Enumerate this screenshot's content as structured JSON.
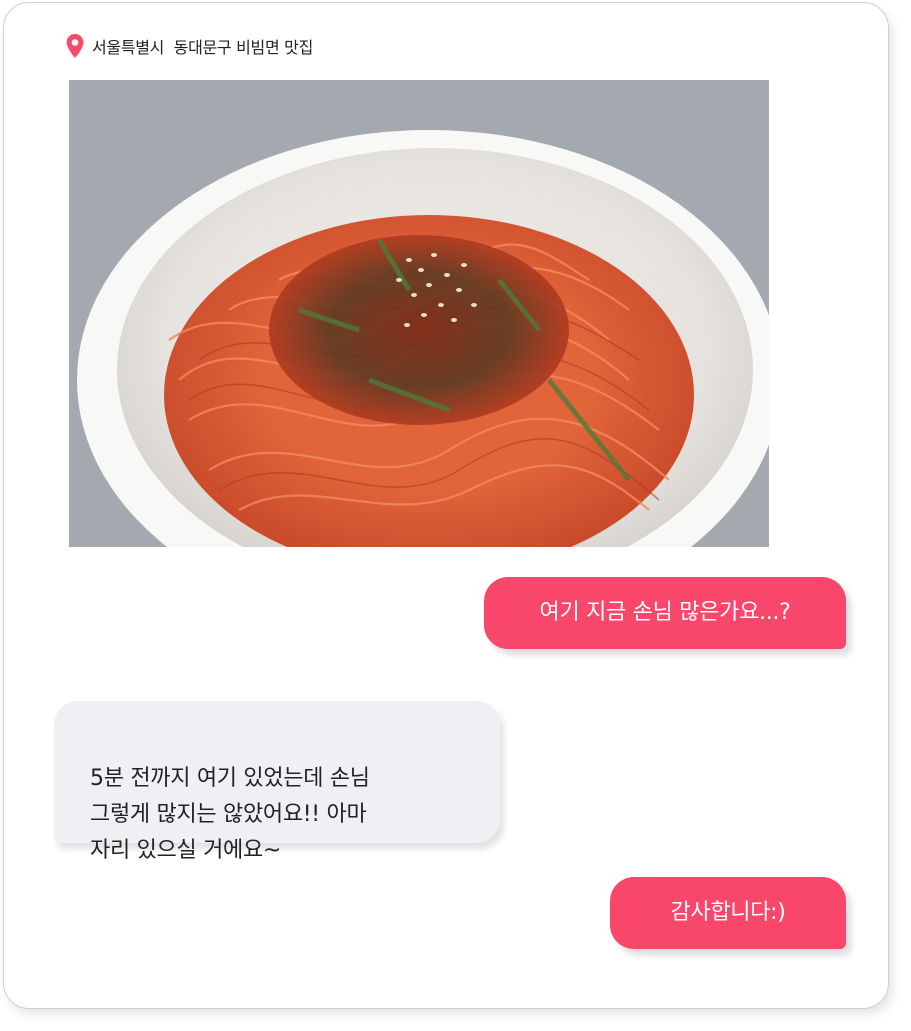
{
  "location": {
    "icon": "map-pin-icon",
    "icon_color": "#f94a6c",
    "text": "서울특별시  동대문구 비빔면 맛집"
  },
  "photo": {
    "subject": "food-photo"
  },
  "messages": [
    {
      "sender": "me",
      "text": "여기 지금 손님 많은가요...?"
    },
    {
      "sender": "other",
      "text": "5분 전까지 여기 있었는데 손님\n그렇게 많지는 않았어요!! 아마\n자리 있으실 거에요~"
    },
    {
      "sender": "me",
      "text": "감사합니다:)"
    }
  ],
  "colors": {
    "sent_bubble": "#f9476b",
    "received_bubble": "#eff0f4",
    "sent_text": "#ffffff",
    "received_text": "#222222"
  }
}
